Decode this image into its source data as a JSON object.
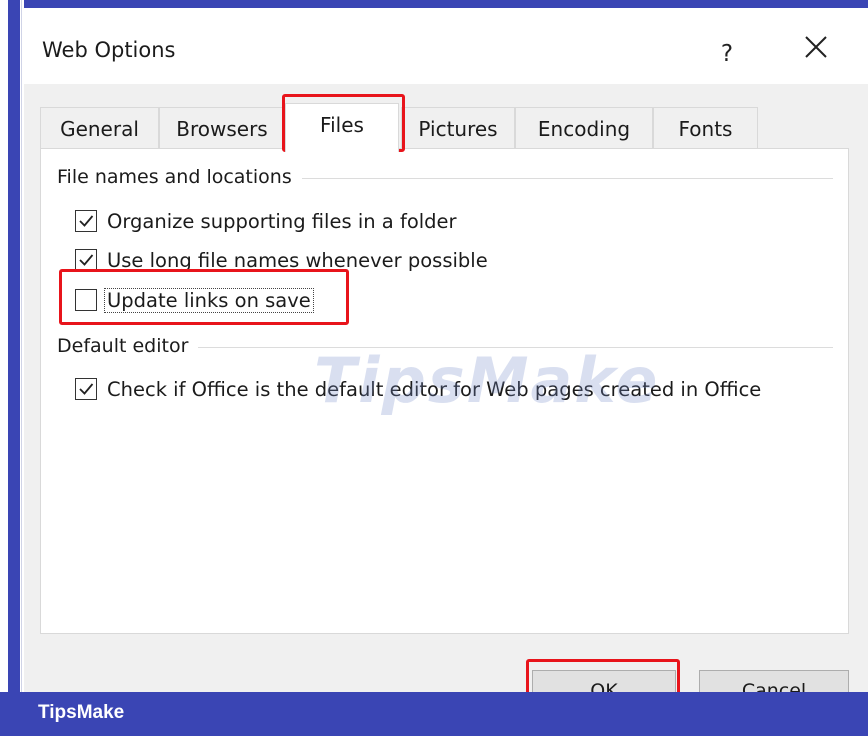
{
  "dialog": {
    "title": "Web Options",
    "help_label": "?",
    "close_icon": "close-icon"
  },
  "tabs": [
    {
      "label": "General",
      "selected": false
    },
    {
      "label": "Browsers",
      "selected": false
    },
    {
      "label": "Files",
      "selected": true
    },
    {
      "label": "Pictures",
      "selected": false
    },
    {
      "label": "Encoding",
      "selected": false
    },
    {
      "label": "Fonts",
      "selected": false
    }
  ],
  "files_tab": {
    "group_file_names": {
      "label": "File names and locations",
      "options": [
        {
          "label": "Organize supporting files in a folder",
          "checked": true
        },
        {
          "label": "Use long file names whenever possible",
          "checked": true
        },
        {
          "label": "Update links on save",
          "checked": false
        }
      ]
    },
    "group_default_editor": {
      "label": "Default editor",
      "options": [
        {
          "label": "Check if Office is the default editor for Web pages created in Office",
          "checked": true
        }
      ]
    }
  },
  "buttons": {
    "ok": "OK",
    "cancel": "Cancel"
  },
  "highlight_color": "#e8141b",
  "watermark": "TipsMake",
  "footer": {
    "brand": "TipsMake"
  }
}
